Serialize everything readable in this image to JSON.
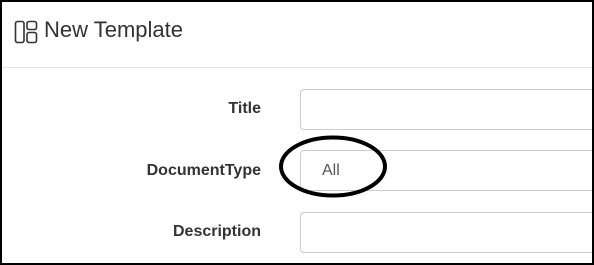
{
  "dialog": {
    "title": "New Template",
    "icon": "template-layout-icon"
  },
  "form": {
    "title_label": "Title",
    "title_value": "",
    "document_type_label": "DocumentType",
    "document_type_value": "All",
    "description_label": "Description",
    "description_value": ""
  },
  "annotation": {
    "type": "ellipse-highlight",
    "color": "#000000",
    "target": "document_type_value"
  },
  "colors": {
    "border": "#cccccc",
    "text": "#333333",
    "divider": "#e5e5e5"
  }
}
